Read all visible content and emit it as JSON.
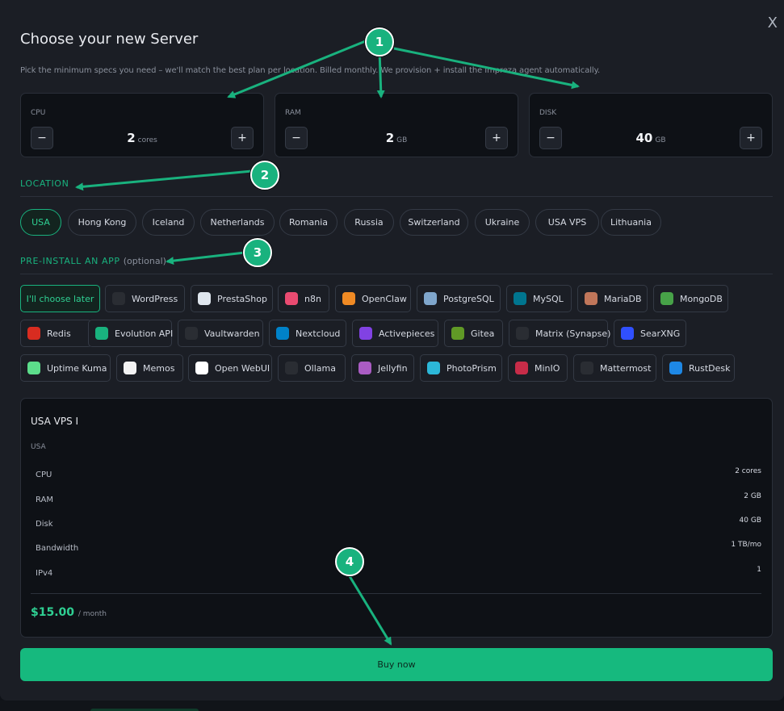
{
  "modal": {
    "close": "X",
    "title": "Choose your new Server",
    "subtitle": "Pick the minimum specs you need – we'll match the best plan per location. Billed monthly. We provision + install the Impreza agent automatically."
  },
  "specs": {
    "cpu": {
      "label": "CPU",
      "value": "2",
      "unit": "cores",
      "minus": "−",
      "plus": "+"
    },
    "ram": {
      "label": "RAM",
      "value": "2",
      "unit": "GB",
      "minus": "−",
      "plus": "+"
    },
    "disk": {
      "label": "DISK",
      "value": "40",
      "unit": "GB",
      "minus": "−",
      "plus": "+"
    }
  },
  "location": {
    "heading": "LOCATION",
    "selected": "USA",
    "options": [
      "USA",
      "Hong Kong",
      "Iceland",
      "Netherlands",
      "Romania",
      "Russia",
      "Switzerland",
      "Ukraine",
      "USA VPS",
      "Lithuania"
    ]
  },
  "apps": {
    "heading": "PRE-INSTALL AN APP",
    "optional": "(optional)",
    "selected": "I'll choose later",
    "items": [
      {
        "label": "I'll choose later",
        "icon": "none"
      },
      {
        "label": "WordPress",
        "icon": "wordpress-icon",
        "color": "#2a2d33"
      },
      {
        "label": "PrestaShop",
        "icon": "prestashop-icon",
        "color": "#dfe6ee"
      },
      {
        "label": "n8n",
        "icon": "n8n-icon",
        "color": "#ea4b71"
      },
      {
        "label": "OpenClaw",
        "icon": "openclaw-icon",
        "color": "#f08a24"
      },
      {
        "label": "PostgreSQL",
        "icon": "postgresql-icon",
        "color": "#7fa6cc"
      },
      {
        "label": "MySQL",
        "icon": "mysql-icon",
        "color": "#00758f"
      },
      {
        "label": "MariaDB",
        "icon": "mariadb-icon",
        "color": "#c0765a"
      },
      {
        "label": "MongoDB",
        "icon": "mongodb-icon",
        "color": "#47a248"
      },
      {
        "label": "Redis",
        "icon": "redis-icon",
        "color": "#d82c20"
      },
      {
        "label": "Evolution API",
        "icon": "evolution-api-icon",
        "color": "#19b27e"
      },
      {
        "label": "Vaultwarden",
        "icon": "vaultwarden-icon",
        "color": "#2a2d33"
      },
      {
        "label": "Nextcloud",
        "icon": "nextcloud-icon",
        "color": "#0082c9"
      },
      {
        "label": "Activepieces",
        "icon": "activepieces-icon",
        "color": "#8142e3"
      },
      {
        "label": "Gitea",
        "icon": "gitea-icon",
        "color": "#609926"
      },
      {
        "label": "Matrix (Synapse)",
        "icon": "matrix-icon",
        "color": "#2a2d33"
      },
      {
        "label": "SearXNG",
        "icon": "searxng-icon",
        "color": "#3050ff"
      },
      {
        "label": "Uptime Kuma",
        "icon": "uptime-kuma-icon",
        "color": "#5cdd8b"
      },
      {
        "label": "Memos",
        "icon": "memos-icon",
        "color": "#f3f3f3"
      },
      {
        "label": "Open WebUI",
        "icon": "open-webui-icon",
        "color": "#ffffff"
      },
      {
        "label": "Ollama",
        "icon": "ollama-icon",
        "color": "#2a2d33"
      },
      {
        "label": "Jellyfin",
        "icon": "jellyfin-icon",
        "color": "#aa5cc3"
      },
      {
        "label": "PhotoPrism",
        "icon": "photoprism-icon",
        "color": "#2cb7d8"
      },
      {
        "label": "MinIO",
        "icon": "minio-icon",
        "color": "#c72c48"
      },
      {
        "label": "Mattermost",
        "icon": "mattermost-icon",
        "color": "#2a2d33"
      },
      {
        "label": "RustDesk",
        "icon": "rustdesk-icon",
        "color": "#1e88e5"
      }
    ]
  },
  "plan": {
    "name": "USA VPS I",
    "location": "USA",
    "rows": [
      {
        "key": "CPU",
        "value": "2 cores"
      },
      {
        "key": "RAM",
        "value": "2 GB"
      },
      {
        "key": "Disk",
        "value": "40 GB"
      },
      {
        "key": "Bandwidth",
        "value": "1 TB/mo"
      },
      {
        "key": "IPv4",
        "value": "1"
      }
    ],
    "price": "$15.00",
    "period": "/ month"
  },
  "buy_label": "Buy now",
  "annotations": [
    "1",
    "2",
    "3",
    "4"
  ],
  "colors": {
    "accent": "#19b27e",
    "buy": "#16b97e",
    "panel": "#1b1e25",
    "card": "#0e1116"
  }
}
